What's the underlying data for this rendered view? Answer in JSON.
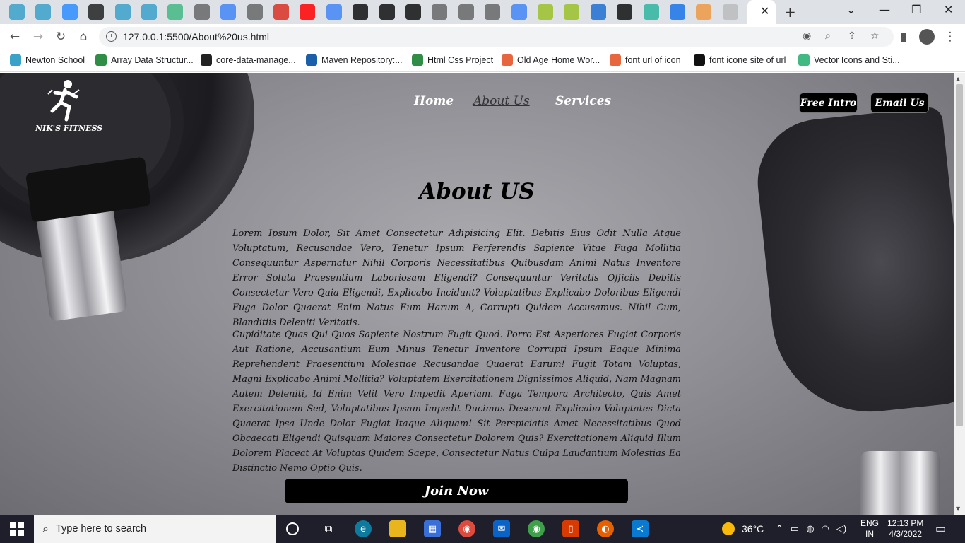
{
  "browser": {
    "url": "127.0.0.1:5500/About%20us.html",
    "tabs": [
      {
        "icon": "newton-icon",
        "color": "#3aa1c9"
      },
      {
        "icon": "newton-icon",
        "color": "#3aa1c9"
      },
      {
        "icon": "zoom-icon",
        "color": "#2d8cff"
      },
      {
        "icon": "github-icon",
        "color": "#222"
      },
      {
        "icon": "newton-icon",
        "color": "#3aa1c9"
      },
      {
        "icon": "newton-icon",
        "color": "#3aa1c9"
      },
      {
        "icon": "vue-icon",
        "color": "#42b883"
      },
      {
        "icon": "globe-icon",
        "color": "#666"
      },
      {
        "icon": "google-icon",
        "color": "#4285f4"
      },
      {
        "icon": "globe-icon",
        "color": "#666"
      },
      {
        "icon": "gmail-icon",
        "color": "#d93025"
      },
      {
        "icon": "youtube-icon",
        "color": "#ff0000"
      },
      {
        "icon": "google-icon",
        "color": "#4285f4"
      },
      {
        "icon": "flag-icon",
        "color": "#111"
      },
      {
        "icon": "medium-icon",
        "color": "#111"
      },
      {
        "icon": "medium-icon",
        "color": "#111"
      },
      {
        "icon": "globe-icon",
        "color": "#666"
      },
      {
        "icon": "globe-icon",
        "color": "#666"
      },
      {
        "icon": "chrome-icon",
        "color": "#666"
      },
      {
        "icon": "google-icon",
        "color": "#4285f4"
      },
      {
        "icon": "image-icon",
        "color": "#9bbf2a"
      },
      {
        "icon": "image-icon",
        "color": "#9bbf2a"
      },
      {
        "icon": "pb-icon",
        "color": "#1f6fd1"
      },
      {
        "icon": "medium-icon",
        "color": "#111"
      },
      {
        "icon": "d-icon",
        "color": "#2eb4a0"
      },
      {
        "icon": "download-icon",
        "color": "#1a73e8"
      },
      {
        "icon": "puzzle-icon",
        "color": "#e94"
      },
      {
        "icon": "pattern-icon",
        "color": "#bbb"
      }
    ],
    "bookmarks": [
      {
        "label": "Newton School",
        "icon": "newton-icon",
        "color": "#3aa1c9"
      },
      {
        "label": "Array Data Structur...",
        "icon": "gfg-icon",
        "color": "#2f8d46"
      },
      {
        "label": "core-data-manage...",
        "icon": "github-icon",
        "color": "#222"
      },
      {
        "label": "Maven Repository:...",
        "icon": "maven-icon",
        "color": "#1a5faa"
      },
      {
        "label": "Html Css Project",
        "icon": "gfg-icon",
        "color": "#2f8d46"
      },
      {
        "label": "Old Age Home Wor...",
        "icon": "tk-icon",
        "color": "#e8663d"
      },
      {
        "label": "font url of icon",
        "icon": "code-icon",
        "color": "#e8663d"
      },
      {
        "label": "font icone site of url",
        "icon": "flag-icon",
        "color": "#111"
      },
      {
        "label": "Vector Icons and Sti...",
        "icon": "vue-icon",
        "color": "#42b883"
      }
    ]
  },
  "site": {
    "logo_text": "NIK'S FITNESS",
    "nav": [
      "Home",
      "About Us",
      "Services"
    ],
    "free_intro": "Free Intro",
    "email_us": "Email Us",
    "title": "About US",
    "para1": "Lorem Ipsum Dolor, Sit Amet Consectetur Adipisicing Elit. Debitis Eius Odit Nulla Atque Voluptatum, Recusandae Vero, Tenetur Ipsum Perferendis Sapiente Vitae Fuga Mollitia Consequuntur Aspernatur Nihil Corporis Necessitatibus Quibusdam Animi Natus Inventore Error Soluta Praesentium Laboriosam Eligendi? Consequuntur Veritatis Officiis Debitis Consectetur Vero Quia Eligendi, Explicabo Incidunt? Voluptatibus Explicabo Doloribus Eligendi Fuga Dolor Quaerat Enim Natus Eum Harum A, Corrupti Quidem Accusamus. Nihil Cum, Blanditiis Deleniti Veritatis.",
    "para2": "Cupiditate Quas Qui Quos Sapiente Nostrum Fugit Quod. Porro Est Asperiores Fugiat Corporis Aut Ratione, Accusantium Eum Minus Tenetur Inventore Corrupti Ipsum Eaque Minima Reprehenderit Praesentium Molestiae Recusandae Quaerat Earum! Fugit Totam Voluptas, Magni Explicabo Animi Mollitia? Voluptatem Exercitationem Dignissimos Aliquid, Nam Magnam Autem Deleniti, Id Enim Velit Vero Impedit Aperiam. Fuga Tempora Architecto, Quis Amet Exercitationem Sed, Voluptatibus Ipsam Impedit Ducimus Deserunt Explicabo Voluptates Dicta Quaerat Ipsa Unde Dolor Fugiat Itaque Aliquam! Sit Perspiciatis Amet Necessitatibus Quod Obcaecati Eligendi Quisquam Maiores Consectetur Dolorem Quis? Exercitationem Aliquid Illum Dolorem Placeat At Voluptas Quidem Saepe, Consectetur Natus Culpa Laudantium Molestias Ea Distinctio Nemo Optio Quis.",
    "join": "Join Now"
  },
  "taskbar": {
    "search_placeholder": "Type here to search",
    "weather": "36°C",
    "lang": "ENG",
    "region": "IN",
    "time": "12:13 PM",
    "date": "4/3/2022"
  }
}
